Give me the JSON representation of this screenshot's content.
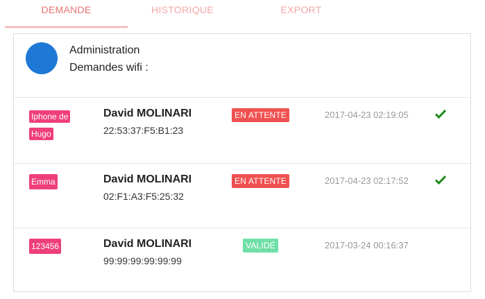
{
  "tabs": [
    {
      "label": "DEMANDE",
      "active": true
    },
    {
      "label": "HISTORIQUE",
      "active": false
    },
    {
      "label": "EXPORT",
      "active": false
    }
  ],
  "header": {
    "title": "Administration",
    "subtitle": "Demandes wifi :"
  },
  "requests": [
    {
      "device": "Iphone de Hugo",
      "user": "David MOLINARI",
      "mac": "22:53:37:F5:B1:23",
      "status": "EN ATTENTE",
      "timestamp": "2017-04-23 02:19:05",
      "action_icon": "check-icon"
    },
    {
      "device": "Emma",
      "user": "David MOLINARI",
      "mac": "02:F1:A3:F5:25:32",
      "status": "EN ATTENTE",
      "timestamp": "2017-04-23 02:17:52",
      "action_icon": "check-icon"
    },
    {
      "device": "123456",
      "user": "David MOLINARI",
      "mac": "99:99:99:99:99:99",
      "status": "VALIDÉ",
      "timestamp": "2017-03-24 00:16:37"
    }
  ],
  "colors": {
    "accent": "#e57373",
    "avatar": "#1e78d6",
    "device_tag": "#ef3f7a",
    "status_pending": "#f05050",
    "status_valid": "#6fe0a8",
    "check": "#1a8a1a"
  }
}
